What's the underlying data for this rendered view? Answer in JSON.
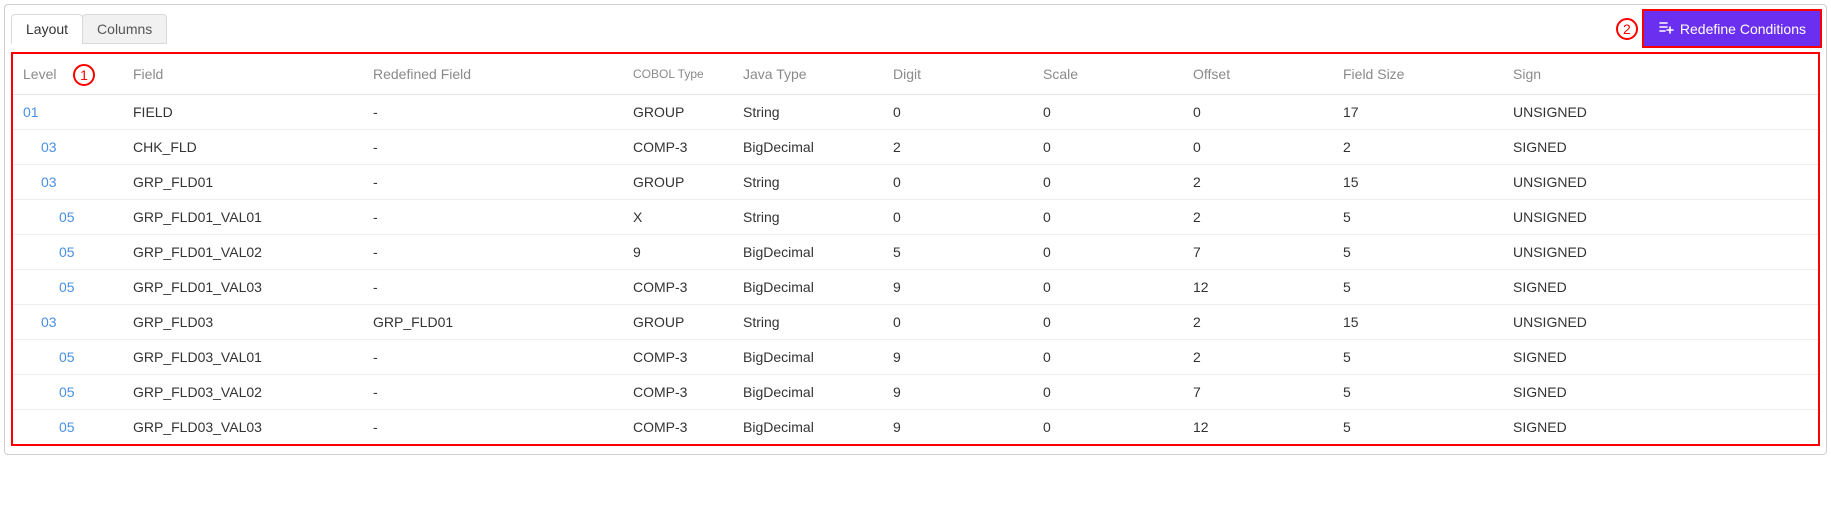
{
  "tabs": {
    "layout": "Layout",
    "columns": "Columns"
  },
  "actions": {
    "redefine": "Redefine Conditions"
  },
  "callouts": {
    "one": "1",
    "two": "2"
  },
  "table": {
    "headers": {
      "level": "Level",
      "field": "Field",
      "redefined": "Redefined Field",
      "cobol": "COBOL Type",
      "java": "Java Type",
      "digit": "Digit",
      "scale": "Scale",
      "offset": "Offset",
      "size": "Field Size",
      "sign": "Sign"
    },
    "rows": [
      {
        "indent": 0,
        "level": "01",
        "field": "FIELD",
        "redefined": "-",
        "cobol": "GROUP",
        "java": "String",
        "digit": "0",
        "scale": "0",
        "offset": "0",
        "size": "17",
        "sign": "UNSIGNED"
      },
      {
        "indent": 1,
        "level": "03",
        "field": "CHK_FLD",
        "redefined": "-",
        "cobol": "COMP-3",
        "java": "BigDecimal",
        "digit": "2",
        "scale": "0",
        "offset": "0",
        "size": "2",
        "sign": "SIGNED"
      },
      {
        "indent": 1,
        "level": "03",
        "field": "GRP_FLD01",
        "redefined": "-",
        "cobol": "GROUP",
        "java": "String",
        "digit": "0",
        "scale": "0",
        "offset": "2",
        "size": "15",
        "sign": "UNSIGNED"
      },
      {
        "indent": 2,
        "level": "05",
        "field": "GRP_FLD01_VAL01",
        "redefined": "-",
        "cobol": "X",
        "java": "String",
        "digit": "0",
        "scale": "0",
        "offset": "2",
        "size": "5",
        "sign": "UNSIGNED"
      },
      {
        "indent": 2,
        "level": "05",
        "field": "GRP_FLD01_VAL02",
        "redefined": "-",
        "cobol": "9",
        "java": "BigDecimal",
        "digit": "5",
        "scale": "0",
        "offset": "7",
        "size": "5",
        "sign": "UNSIGNED"
      },
      {
        "indent": 2,
        "level": "05",
        "field": "GRP_FLD01_VAL03",
        "redefined": "-",
        "cobol": "COMP-3",
        "java": "BigDecimal",
        "digit": "9",
        "scale": "0",
        "offset": "12",
        "size": "5",
        "sign": "SIGNED"
      },
      {
        "indent": 1,
        "level": "03",
        "field": "GRP_FLD03",
        "redefined": "GRP_FLD01",
        "cobol": "GROUP",
        "java": "String",
        "digit": "0",
        "scale": "0",
        "offset": "2",
        "size": "15",
        "sign": "UNSIGNED"
      },
      {
        "indent": 2,
        "level": "05",
        "field": "GRP_FLD03_VAL01",
        "redefined": "-",
        "cobol": "COMP-3",
        "java": "BigDecimal",
        "digit": "9",
        "scale": "0",
        "offset": "2",
        "size": "5",
        "sign": "SIGNED"
      },
      {
        "indent": 2,
        "level": "05",
        "field": "GRP_FLD03_VAL02",
        "redefined": "-",
        "cobol": "COMP-3",
        "java": "BigDecimal",
        "digit": "9",
        "scale": "0",
        "offset": "7",
        "size": "5",
        "sign": "SIGNED"
      },
      {
        "indent": 2,
        "level": "05",
        "field": "GRP_FLD03_VAL03",
        "redefined": "-",
        "cobol": "COMP-3",
        "java": "BigDecimal",
        "digit": "9",
        "scale": "0",
        "offset": "12",
        "size": "5",
        "sign": "SIGNED"
      }
    ]
  }
}
